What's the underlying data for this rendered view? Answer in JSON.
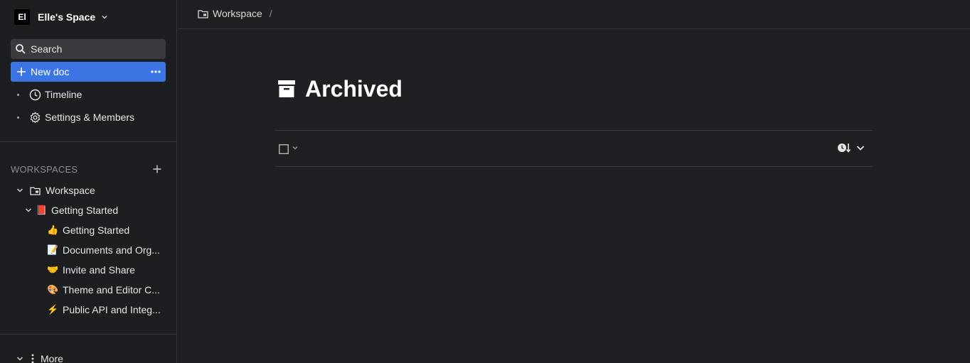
{
  "sidebar": {
    "space": {
      "avatar_text": "El",
      "name": "Elle's Space"
    },
    "search_label": "Search",
    "new_doc_label": "New doc",
    "nav": [
      {
        "label": "Timeline",
        "icon": "clock-icon"
      },
      {
        "label": "Settings & Members",
        "icon": "gear-icon"
      }
    ],
    "workspaces_heading": "WORKSPACES",
    "tree": {
      "workspace": "Workspace",
      "folder": {
        "label": "Getting Started",
        "emoji": "📕"
      },
      "docs": [
        {
          "emoji": "👍",
          "label": "Getting Started"
        },
        {
          "emoji": "📝",
          "label": "Documents and Org..."
        },
        {
          "emoji": "🤝",
          "label": "Invite and Share"
        },
        {
          "emoji": "🎨",
          "label": "Theme and Editor C..."
        },
        {
          "emoji": "⚡",
          "label": "Public API and Integ..."
        }
      ]
    },
    "more_label": "More"
  },
  "breadcrumb": {
    "label": "Workspace",
    "separator": "/"
  },
  "main": {
    "title": "Archived"
  },
  "colors": {
    "accent": "#3b75e3",
    "background": "#1f2023",
    "sidebar": "#1d1e21"
  }
}
